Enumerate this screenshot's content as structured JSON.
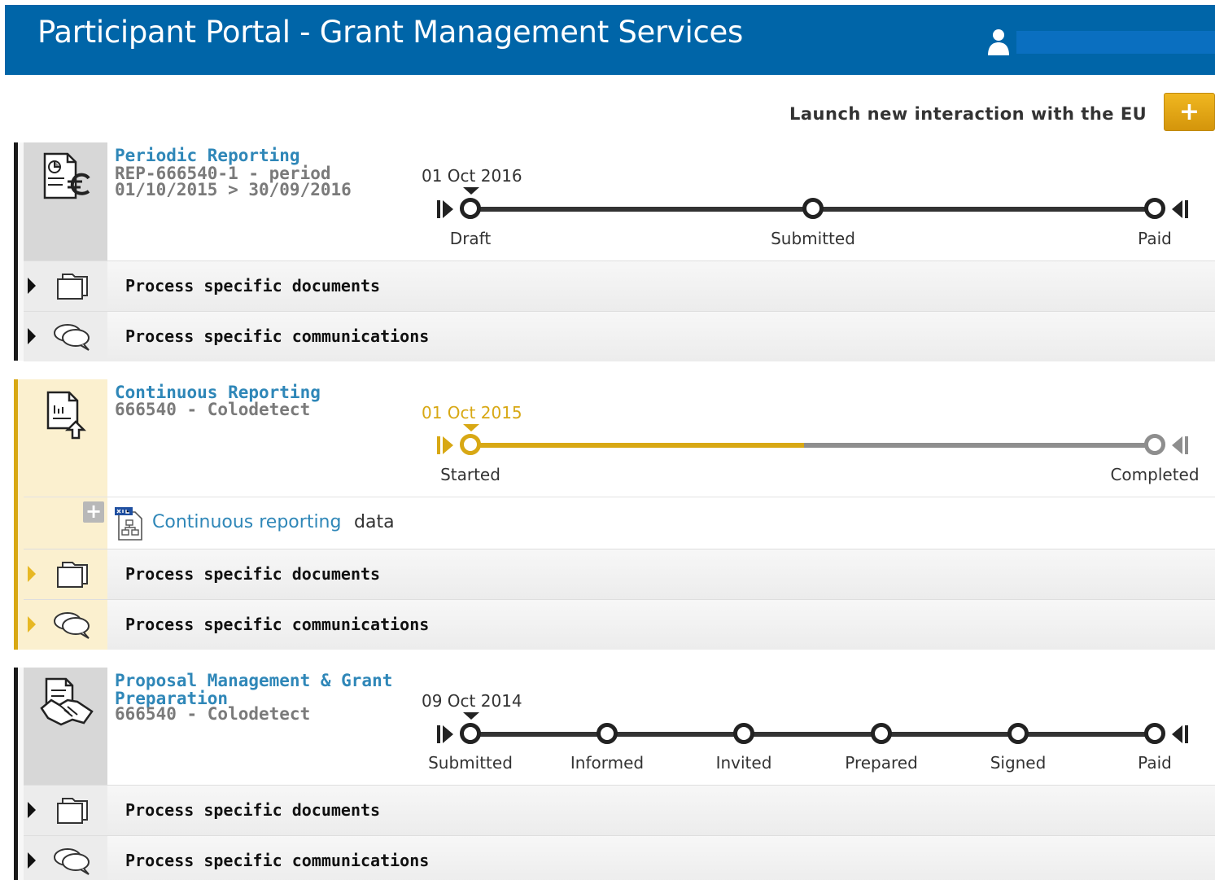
{
  "header": {
    "title": "Participant Portal - Grant Management Services",
    "user_icon": "user-icon"
  },
  "launch": {
    "label": "Launch new interaction with the EU",
    "button_label": "+"
  },
  "processes": [
    {
      "title": "Periodic Reporting",
      "subtitle_lines": [
        "REP-666540-1 - period",
        "01/10/2015 > 30/09/2016"
      ],
      "icon": "report-euro-icon",
      "timeline": {
        "date": "01 Oct 2016",
        "steps": [
          "Draft",
          "Submitted",
          "Paid"
        ],
        "current_step": 0
      },
      "rows": [
        "Process specific documents",
        "Process specific communications"
      ]
    },
    {
      "title": "Continuous Reporting",
      "subtitle_lines": [
        "666540 - Colodetect"
      ],
      "icon": "document-upload-icon",
      "timeline": {
        "date": "01 Oct 2015",
        "steps": [
          "Started",
          "Completed"
        ],
        "current_step": 0,
        "progress": 0.5
      },
      "data_link": {
        "link_text": "Continuous reporting",
        "text": "data",
        "expand_label": "+",
        "icon": "xml-file-icon"
      },
      "rows": [
        "Process specific documents",
        "Process specific communications"
      ]
    },
    {
      "title_lines": [
        "Proposal Management & Grant",
        "Preparation"
      ],
      "subtitle_lines": [
        "666540 - Colodetect"
      ],
      "icon": "handshake-icon",
      "timeline": {
        "date": "09 Oct 2014",
        "steps": [
          "Submitted",
          "Informed",
          "Invited",
          "Prepared",
          "Signed",
          "Paid"
        ],
        "current_step": 0
      },
      "rows": [
        "Process specific documents",
        "Process specific communications"
      ]
    }
  ],
  "colors": {
    "header_blue": "#0065a8",
    "accent_gold": "#d8a814",
    "link_blue": "#2f87b8",
    "launch_button": "#e0a514"
  }
}
